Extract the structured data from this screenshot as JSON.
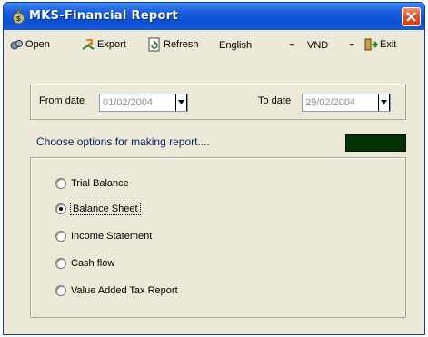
{
  "window": {
    "title": "MKS-Financial Report"
  },
  "toolbar": {
    "open_label": "Open",
    "export_label": "Export",
    "refresh_label": "Refresh",
    "language": "English",
    "currency": "VND",
    "exit_label": "Exit"
  },
  "dates": {
    "from_label": "From date",
    "from_value": "01/02/2004",
    "to_label": "To date",
    "to_value": "29/02/2004"
  },
  "options": {
    "heading": "Choose options for making report....",
    "selected_index": 1,
    "items": [
      {
        "label": "Trial Balance"
      },
      {
        "label": "Balance Sheet"
      },
      {
        "label": "Income Statement"
      },
      {
        "label": "Cash flow"
      },
      {
        "label": "Value Added Tax Report"
      }
    ]
  },
  "colors": {
    "title_bar": "#0a4fd2",
    "heading_text": "#0a246a",
    "status_box": "#003300",
    "window_bg": "#ece9d8"
  }
}
